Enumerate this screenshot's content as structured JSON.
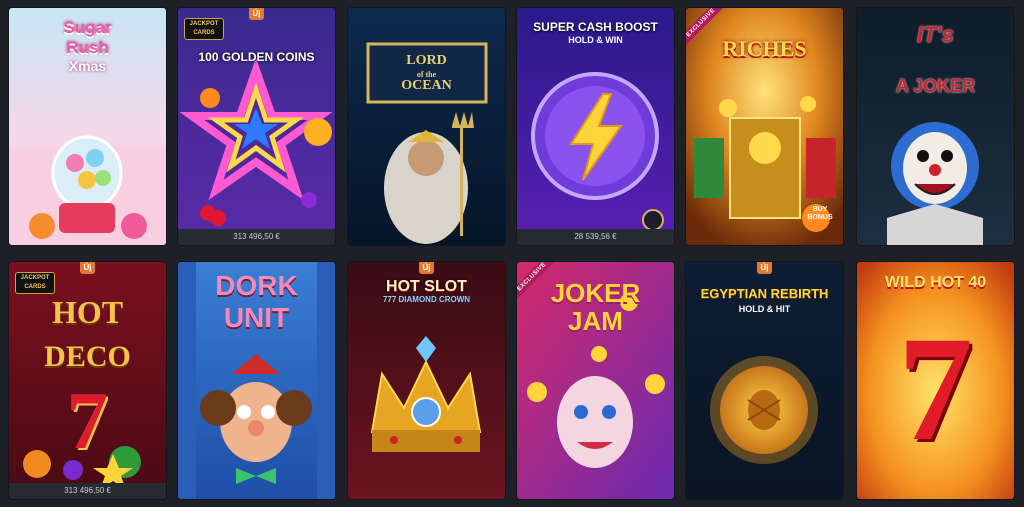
{
  "tiles": [
    {
      "title_line1": "Sugar",
      "title_line2": "Rush",
      "title_line3": "Xmas",
      "jackpot": "",
      "badge": "",
      "exclusive": ""
    },
    {
      "title": "100 GOLDEN COINS",
      "jackpot": "313 496,50 €",
      "badge": "Új",
      "logo_line1": "JACKPOT",
      "logo_line2": "CARDS"
    },
    {
      "title_line1": "LORD",
      "title_line2": "of the",
      "title_line3": "OCEAN"
    },
    {
      "title_line1": "SUPER CASH BOOST",
      "title_line2": "HOLD & WIN",
      "jackpot": "28 539,56 €"
    },
    {
      "title": "RICHES",
      "exclusive": "EXCLUSIVE",
      "buy_bonus": "BUY BONUS"
    },
    {
      "title_line1": "IT's",
      "title_line2": "A JOKER"
    },
    {
      "title_line1": "HOT",
      "title_line2": "DECO",
      "digit": "7",
      "jackpot": "313 496,50 €",
      "badge": "Új",
      "logo_line1": "JACKPOT",
      "logo_line2": "CARDS"
    },
    {
      "title_line1": "DORK",
      "title_line2": "UNIT"
    },
    {
      "title_line1": "HOT SLOT",
      "title_line2": "777 DIAMOND CROWN",
      "badge": "Új"
    },
    {
      "title_line1": "JOKER",
      "title_line2": "JAM",
      "exclusive": "EXCLUSIVE"
    },
    {
      "title_line1": "EGYPTIAN REBIRTH",
      "title_line2": "HOLD & HIT",
      "badge": "Új"
    },
    {
      "title": "WILD HOT 40",
      "digit": "7"
    }
  ]
}
